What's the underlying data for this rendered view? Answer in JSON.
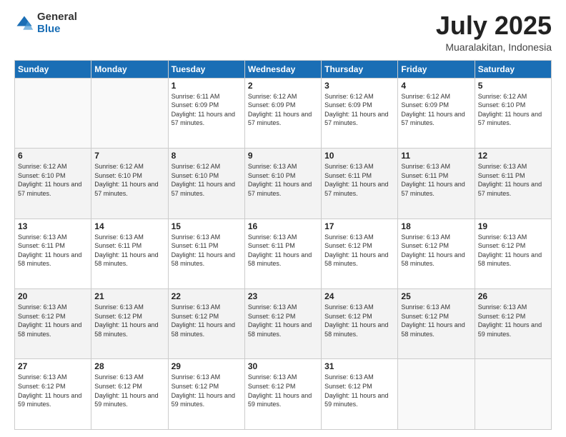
{
  "logo": {
    "general": "General",
    "blue": "Blue"
  },
  "header": {
    "month": "July 2025",
    "location": "Muaralakitan, Indonesia"
  },
  "days_of_week": [
    "Sunday",
    "Monday",
    "Tuesday",
    "Wednesday",
    "Thursday",
    "Friday",
    "Saturday"
  ],
  "weeks": [
    [
      {
        "day": "",
        "info": ""
      },
      {
        "day": "",
        "info": ""
      },
      {
        "day": "1",
        "info": "Sunrise: 6:11 AM\nSunset: 6:09 PM\nDaylight: 11 hours and 57 minutes."
      },
      {
        "day": "2",
        "info": "Sunrise: 6:12 AM\nSunset: 6:09 PM\nDaylight: 11 hours and 57 minutes."
      },
      {
        "day": "3",
        "info": "Sunrise: 6:12 AM\nSunset: 6:09 PM\nDaylight: 11 hours and 57 minutes."
      },
      {
        "day": "4",
        "info": "Sunrise: 6:12 AM\nSunset: 6:09 PM\nDaylight: 11 hours and 57 minutes."
      },
      {
        "day": "5",
        "info": "Sunrise: 6:12 AM\nSunset: 6:10 PM\nDaylight: 11 hours and 57 minutes."
      }
    ],
    [
      {
        "day": "6",
        "info": "Sunrise: 6:12 AM\nSunset: 6:10 PM\nDaylight: 11 hours and 57 minutes."
      },
      {
        "day": "7",
        "info": "Sunrise: 6:12 AM\nSunset: 6:10 PM\nDaylight: 11 hours and 57 minutes."
      },
      {
        "day": "8",
        "info": "Sunrise: 6:12 AM\nSunset: 6:10 PM\nDaylight: 11 hours and 57 minutes."
      },
      {
        "day": "9",
        "info": "Sunrise: 6:13 AM\nSunset: 6:10 PM\nDaylight: 11 hours and 57 minutes."
      },
      {
        "day": "10",
        "info": "Sunrise: 6:13 AM\nSunset: 6:11 PM\nDaylight: 11 hours and 57 minutes."
      },
      {
        "day": "11",
        "info": "Sunrise: 6:13 AM\nSunset: 6:11 PM\nDaylight: 11 hours and 57 minutes."
      },
      {
        "day": "12",
        "info": "Sunrise: 6:13 AM\nSunset: 6:11 PM\nDaylight: 11 hours and 57 minutes."
      }
    ],
    [
      {
        "day": "13",
        "info": "Sunrise: 6:13 AM\nSunset: 6:11 PM\nDaylight: 11 hours and 58 minutes."
      },
      {
        "day": "14",
        "info": "Sunrise: 6:13 AM\nSunset: 6:11 PM\nDaylight: 11 hours and 58 minutes."
      },
      {
        "day": "15",
        "info": "Sunrise: 6:13 AM\nSunset: 6:11 PM\nDaylight: 11 hours and 58 minutes."
      },
      {
        "day": "16",
        "info": "Sunrise: 6:13 AM\nSunset: 6:11 PM\nDaylight: 11 hours and 58 minutes."
      },
      {
        "day": "17",
        "info": "Sunrise: 6:13 AM\nSunset: 6:12 PM\nDaylight: 11 hours and 58 minutes."
      },
      {
        "day": "18",
        "info": "Sunrise: 6:13 AM\nSunset: 6:12 PM\nDaylight: 11 hours and 58 minutes."
      },
      {
        "day": "19",
        "info": "Sunrise: 6:13 AM\nSunset: 6:12 PM\nDaylight: 11 hours and 58 minutes."
      }
    ],
    [
      {
        "day": "20",
        "info": "Sunrise: 6:13 AM\nSunset: 6:12 PM\nDaylight: 11 hours and 58 minutes."
      },
      {
        "day": "21",
        "info": "Sunrise: 6:13 AM\nSunset: 6:12 PM\nDaylight: 11 hours and 58 minutes."
      },
      {
        "day": "22",
        "info": "Sunrise: 6:13 AM\nSunset: 6:12 PM\nDaylight: 11 hours and 58 minutes."
      },
      {
        "day": "23",
        "info": "Sunrise: 6:13 AM\nSunset: 6:12 PM\nDaylight: 11 hours and 58 minutes."
      },
      {
        "day": "24",
        "info": "Sunrise: 6:13 AM\nSunset: 6:12 PM\nDaylight: 11 hours and 58 minutes."
      },
      {
        "day": "25",
        "info": "Sunrise: 6:13 AM\nSunset: 6:12 PM\nDaylight: 11 hours and 58 minutes."
      },
      {
        "day": "26",
        "info": "Sunrise: 6:13 AM\nSunset: 6:12 PM\nDaylight: 11 hours and 59 minutes."
      }
    ],
    [
      {
        "day": "27",
        "info": "Sunrise: 6:13 AM\nSunset: 6:12 PM\nDaylight: 11 hours and 59 minutes."
      },
      {
        "day": "28",
        "info": "Sunrise: 6:13 AM\nSunset: 6:12 PM\nDaylight: 11 hours and 59 minutes."
      },
      {
        "day": "29",
        "info": "Sunrise: 6:13 AM\nSunset: 6:12 PM\nDaylight: 11 hours and 59 minutes."
      },
      {
        "day": "30",
        "info": "Sunrise: 6:13 AM\nSunset: 6:12 PM\nDaylight: 11 hours and 59 minutes."
      },
      {
        "day": "31",
        "info": "Sunrise: 6:13 AM\nSunset: 6:12 PM\nDaylight: 11 hours and 59 minutes."
      },
      {
        "day": "",
        "info": ""
      },
      {
        "day": "",
        "info": ""
      }
    ]
  ]
}
